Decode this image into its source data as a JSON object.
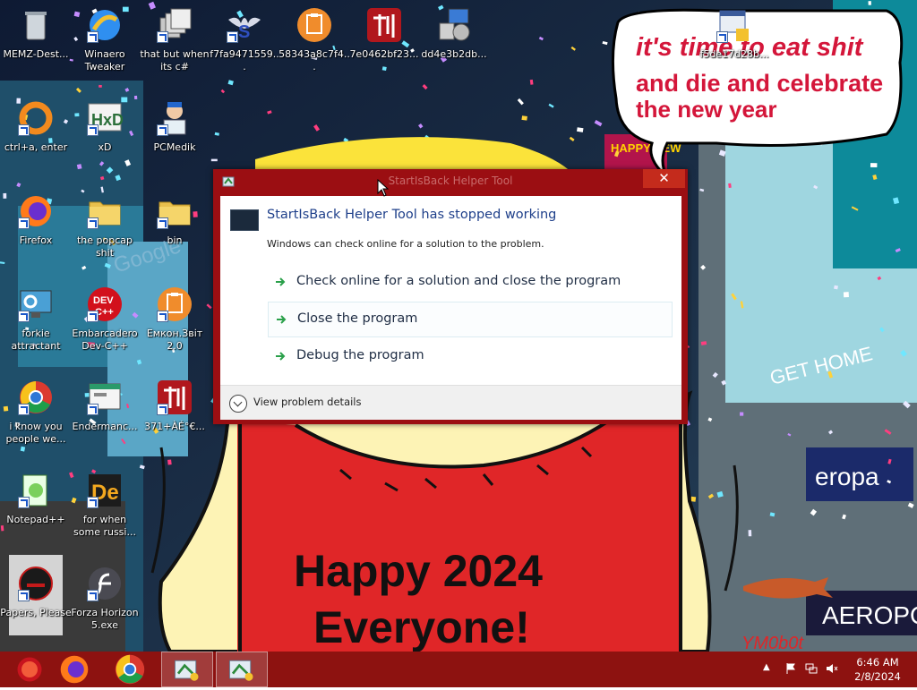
{
  "desktop": {
    "icons": [
      {
        "label": "MEMZ-Dest...",
        "icon": "recycle-bin-icon"
      },
      {
        "label": "Winaero Tweaker",
        "icon": "winaero-icon"
      },
      {
        "label": "that but when its c#",
        "icon": "windows-stack-icon"
      },
      {
        "label": "f7fa9471559...",
        "icon": "skull-wings-icon"
      },
      {
        "label": "58343a8c7f4...",
        "icon": "clipboard-orange-icon"
      },
      {
        "label": "7e0462bf23...",
        "icon": "red-glyph-icon"
      },
      {
        "label": "dd4e3b2db...",
        "icon": "setup-computer-icon"
      },
      {
        "label": "f5de17d28b...",
        "icon": "setup-window-icon"
      },
      {
        "label": "ctrl+a, enter",
        "icon": "orange-ring-icon"
      },
      {
        "label": "xD",
        "icon": "hxd-icon"
      },
      {
        "label": "PCMedik",
        "icon": "doctor-icon"
      },
      {
        "label": "Firefox",
        "icon": "firefox-icon"
      },
      {
        "label": "the popcap shit",
        "icon": "folder-icon"
      },
      {
        "label": "bin",
        "icon": "folder-icon"
      },
      {
        "label": "forkie attractant",
        "icon": "monitor-gear-icon"
      },
      {
        "label": "Embarcadero Dev-C++",
        "icon": "devcpp-icon"
      },
      {
        "label": "Емкон.Звіт 2.0",
        "icon": "clipboard-orange-icon"
      },
      {
        "label": "i know you people we...",
        "icon": "chrome-icon"
      },
      {
        "label": "Endermanc...",
        "icon": "window-app-icon"
      },
      {
        "label": "371+ÀÉ°€...",
        "icon": "red-glyph-icon"
      },
      {
        "label": "Notepad++",
        "icon": "notepadpp-icon"
      },
      {
        "label": "for when some russi...",
        "icon": "de-icon"
      },
      {
        "label": "Papers, Please",
        "icon": "papers-please-icon"
      },
      {
        "label": "Forza Horizon 5.exe",
        "icon": "flash-icon"
      }
    ]
  },
  "wallpaper": {
    "bubble_line1": "it's time to eat shit",
    "bubble_line2": "and die and celebrate",
    "bubble_line3": "the new year",
    "shirt_line1": "Happy 2024",
    "shirt_line2": "Everyone!",
    "sign_text": "eropa",
    "sign2_text": "AEROPO",
    "gethome_text": "GET HOME",
    "google_text": "Google",
    "happy_text": "HAPPY NEW",
    "signature": "YM0b0t"
  },
  "dialog": {
    "title": "StartIsBack Helper Tool",
    "close_glyph": "✕",
    "heading": "StartIsBack Helper Tool has stopped working",
    "subtext": "Windows can check online for a solution to the problem.",
    "options": [
      {
        "label": "Check online for a solution and close the program"
      },
      {
        "label": "Close the program"
      },
      {
        "label": "Debug the program"
      }
    ],
    "details_label": "View problem details"
  },
  "taskbar": {
    "buttons": [
      {
        "icon": "start-orb-icon"
      },
      {
        "icon": "firefox-icon"
      },
      {
        "icon": "chrome-icon"
      },
      {
        "icon": "error-reporting-icon"
      },
      {
        "icon": "error-reporting-icon"
      }
    ],
    "tray": {
      "icons": [
        "chevron-up-icon",
        "flag-icon",
        "network-icon",
        "volume-muted-icon"
      ]
    },
    "time": "6:46 AM",
    "date": "2/8/2024"
  }
}
